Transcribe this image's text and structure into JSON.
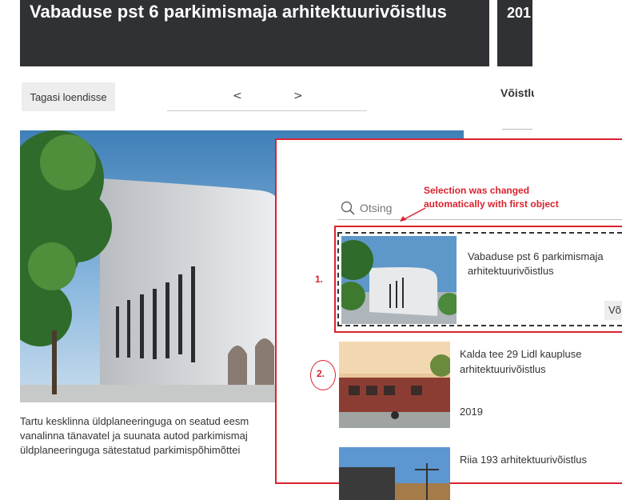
{
  "header": {
    "title": "Vabaduse pst 6 parkimismaja arhitektuurivõistlus",
    "next_title_fragment": "201"
  },
  "nav": {
    "back_label": "Tagasi loendisse",
    "prev_label": "<",
    "next_label": ">"
  },
  "sidebar": {
    "label_fragment": "Võistlu"
  },
  "description": {
    "lines": [
      "Tartu kesklinna üldplaneeringuga on seatud eesm",
      "vanalinna tänavatel ja suunata autod parkimismaj",
      "üldplaneeringuga sätestatud parkimispõhimõttei"
    ]
  },
  "search": {
    "placeholder": "Otsing"
  },
  "annotation": {
    "line1": "Selection was changed",
    "line2": "automatically with first object",
    "marker1": "1.",
    "marker2": "2."
  },
  "list": [
    {
      "name_line1": "Vabaduse pst 6 parkimismaja",
      "name_line2": "arhitektuurivõistlus",
      "badge": "Võ"
    },
    {
      "name_line1": "Kalda tee 29 Lidl kaupluse",
      "name_line2": "arhitektuurivõistlus",
      "year": "2019"
    },
    {
      "name_line1": "Riia 193 arhitektuurivõistlus"
    }
  ],
  "colors": {
    "title_bar": "#2f3134",
    "annotation_red": "#d9232e",
    "button_bg": "#ededed"
  },
  "icons": {
    "search": "search-icon"
  }
}
